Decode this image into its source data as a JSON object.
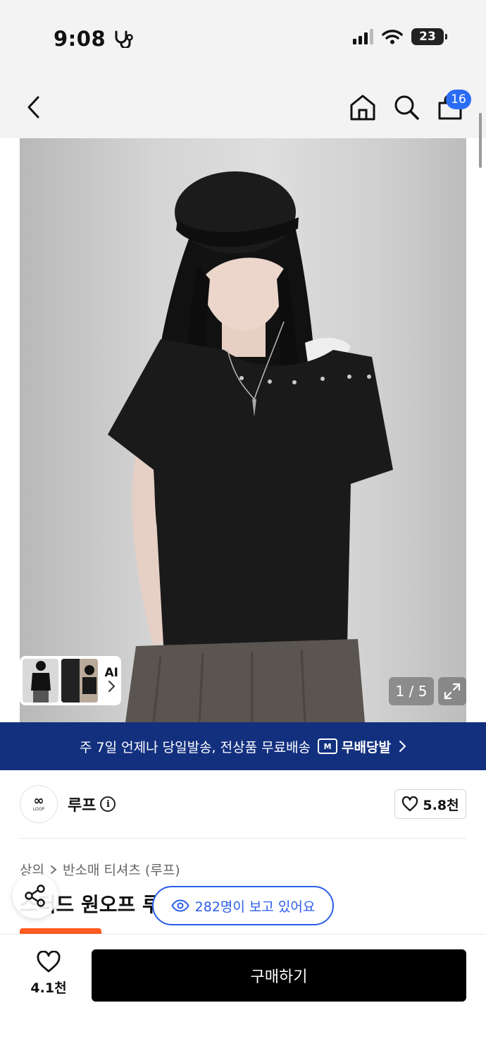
{
  "status_bar": {
    "time": "9:08",
    "battery": "23"
  },
  "top_nav": {
    "cart_count": "16"
  },
  "image": {
    "page_indicator": "1 / 5",
    "ai_label": "AI"
  },
  "promo": {
    "text": "주 7일 언제나 당일발송, 전상품 무료배송",
    "brand": "무배당발",
    "logo_letter": "M"
  },
  "store": {
    "name": "루프",
    "likes": "5.8천",
    "logo_mark": "∞",
    "logo_text": "LOOP"
  },
  "breadcrumb": {
    "category": "상의",
    "subcategory": "반소매 티셔츠 (루프)"
  },
  "product": {
    "title_partial": "스터드 원오프 루"
  },
  "viewers": {
    "text": "282명이 보고 있어요"
  },
  "bottom_bar": {
    "wish_count": "4.1천",
    "buy_label": "구매하기"
  }
}
